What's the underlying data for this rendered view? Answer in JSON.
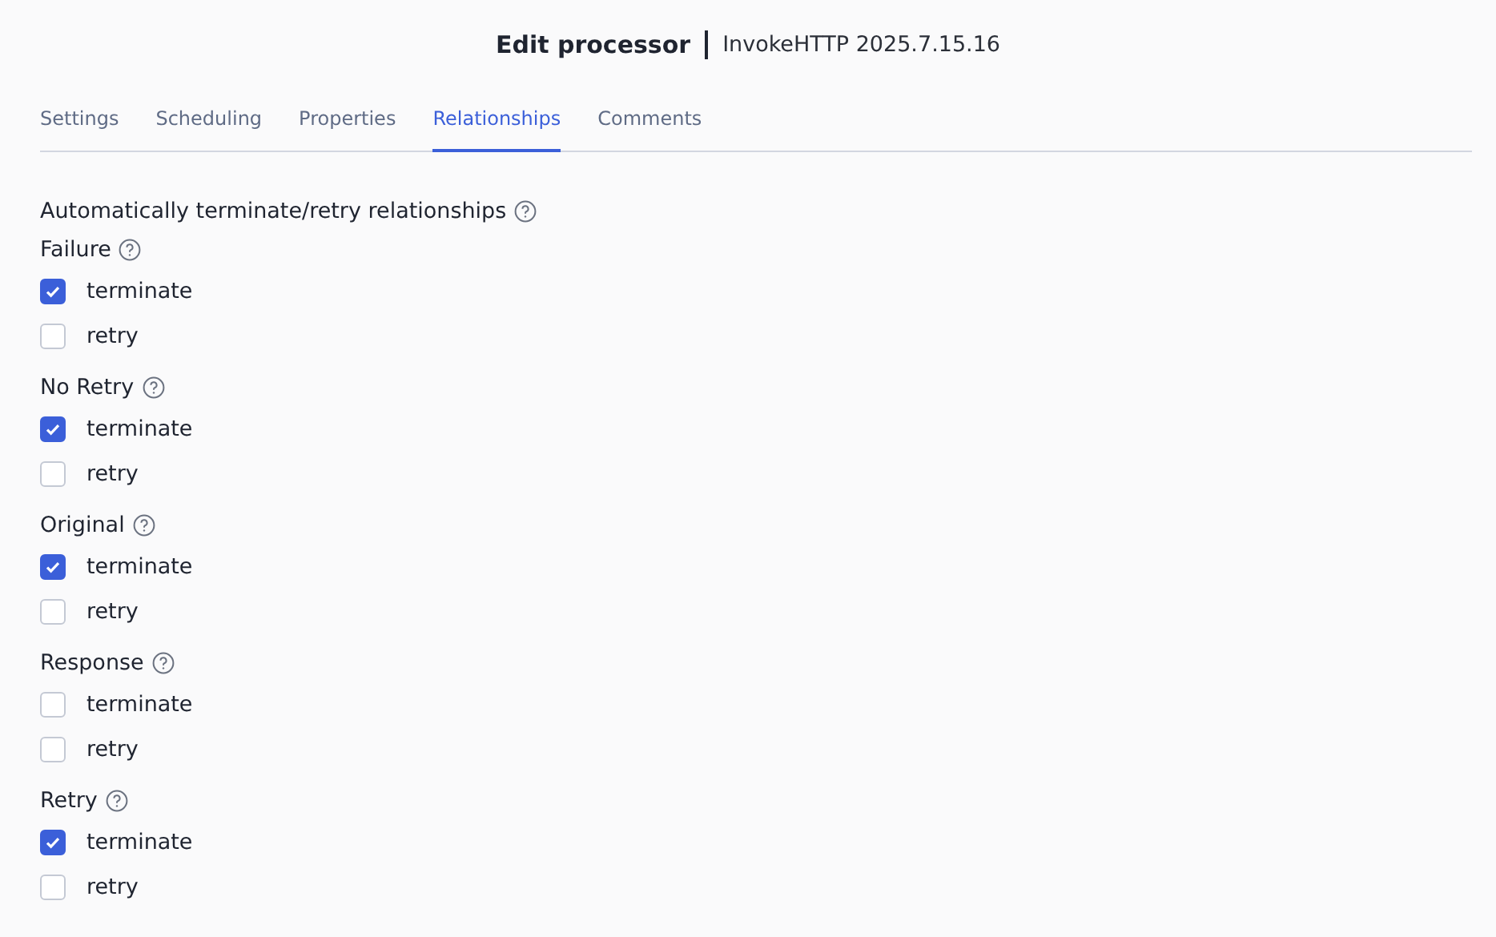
{
  "header": {
    "title": "Edit processor",
    "subtitle": "InvokeHTTP 2025.7.15.16"
  },
  "tabs": [
    {
      "label": "Settings",
      "selected": false
    },
    {
      "label": "Scheduling",
      "selected": false
    },
    {
      "label": "Properties",
      "selected": false
    },
    {
      "label": "Relationships",
      "selected": true
    },
    {
      "label": "Comments",
      "selected": false
    }
  ],
  "section": {
    "heading": "Automatically terminate/retry relationships"
  },
  "relationships": [
    {
      "name": "Failure",
      "options": [
        {
          "label": "terminate",
          "checked": true
        },
        {
          "label": "retry",
          "checked": false
        }
      ]
    },
    {
      "name": "No Retry",
      "options": [
        {
          "label": "terminate",
          "checked": true
        },
        {
          "label": "retry",
          "checked": false
        }
      ]
    },
    {
      "name": "Original",
      "options": [
        {
          "label": "terminate",
          "checked": true
        },
        {
          "label": "retry",
          "checked": false
        }
      ]
    },
    {
      "name": "Response",
      "options": [
        {
          "label": "terminate",
          "checked": false
        },
        {
          "label": "retry",
          "checked": false
        }
      ]
    },
    {
      "name": "Retry",
      "options": [
        {
          "label": "terminate",
          "checked": true
        },
        {
          "label": "retry",
          "checked": false
        }
      ]
    }
  ]
}
